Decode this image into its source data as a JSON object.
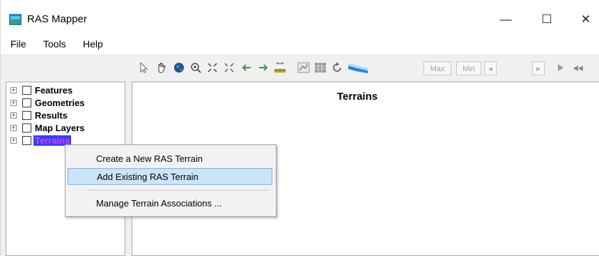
{
  "window": {
    "title": "RAS Mapper",
    "minimize_label": "—",
    "maximize_label": "☐",
    "close_label": "✕"
  },
  "menubar": {
    "items": [
      "File",
      "Tools",
      "Help"
    ]
  },
  "toolbar": {
    "max_label": "Max",
    "min_label": "Min",
    "left_arrow": "◂",
    "right_arrow": "▸"
  },
  "tree": {
    "items": [
      {
        "label": "Features"
      },
      {
        "label": "Geometries"
      },
      {
        "label": "Results"
      },
      {
        "label": "Map Layers"
      },
      {
        "label": "Terrains"
      }
    ],
    "expander": "+"
  },
  "map": {
    "title": "Terrains"
  },
  "context_menu": {
    "items": [
      "Create a New RAS Terrain",
      "Add Existing RAS Terrain",
      "Manage Terrain Associations ..."
    ]
  },
  "colors": {
    "selection_bg": "#3c3cff",
    "selection_text": "#e040e0",
    "highlight_bg": "#cce4f7"
  }
}
